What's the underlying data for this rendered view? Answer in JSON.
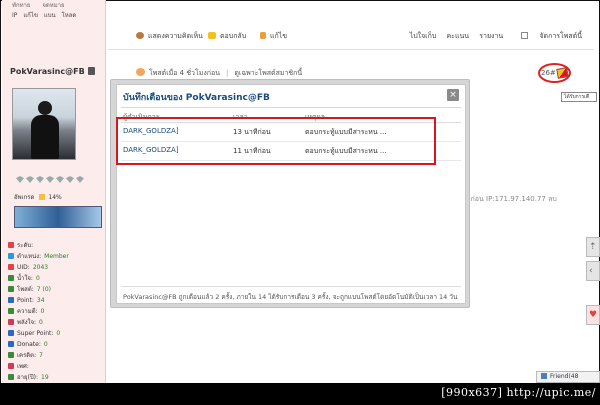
{
  "top_links": {
    "row1": [
      "ทักทาย",
      "จดหมาย"
    ],
    "row2": [
      "IP",
      "แก้ไข",
      "แบน",
      "โหลด"
    ]
  },
  "profile": {
    "username": "PokVarasinc@FB",
    "rank_label": "อัพเกรด",
    "rank_percent": "14%",
    "stats": [
      {
        "icon": "rank-icon",
        "label": "ระดับ:",
        "value": "",
        "color": "#e04444"
      },
      {
        "icon": "position-icon",
        "label": "ตำแหน่ง:",
        "value": "Member",
        "color": "#2a9bd6"
      },
      {
        "icon": "uid-icon",
        "label": "UID:",
        "value": "2043",
        "color": "#e04444"
      },
      {
        "icon": "water-icon",
        "label": "น้ำใจ:",
        "value": "0",
        "color": "#3a8a3a"
      },
      {
        "icon": "post-icon",
        "label": "โพสต์:",
        "value": "7 (0)",
        "color": "#3a8a3a"
      },
      {
        "icon": "point-icon",
        "label": "Point:",
        "value": "34",
        "color": "#2a6ab8"
      },
      {
        "icon": "good-icon",
        "label": "ความดี:",
        "value": "0",
        "color": "#3a8a3a"
      },
      {
        "icon": "heart-icon",
        "label": "พลังใจ:",
        "value": "0",
        "color": "#d23a5a"
      },
      {
        "icon": "super-point-icon",
        "label": "Super Point:",
        "value": "0",
        "color": "#2a6ab8"
      },
      {
        "icon": "donate-icon",
        "label": "Donate:",
        "value": "0",
        "color": "#2a6ab8"
      },
      {
        "icon": "credit-icon",
        "label": "เครดิต:",
        "value": "7",
        "color": "#3a8a3a"
      },
      {
        "icon": "gender-icon",
        "label": "เพศ:",
        "value": "",
        "color": "#d23a5a"
      },
      {
        "icon": "age-icon",
        "label": "อายุ(ปี):",
        "value": "19",
        "color": "#3a8a3a"
      }
    ]
  },
  "toolbar": {
    "comment": "แสดงความคิดเห็น",
    "reply": "ตอบกลับ",
    "edit": "แก้ไข",
    "right_items": [
      "ไปใจเก็บ",
      "คะแนน",
      "รายงาน"
    ],
    "manage": "จัดการโพสต์นี้"
  },
  "post_header": {
    "posted": "โพสต์เมื่อ 4 ชั่วโมงก่อน",
    "members_only": "ดูเฉพาะโพสต์สมาชิกนี้"
  },
  "warnings": {
    "count": "26#",
    "tooltip": "ได้รับการเตื"
  },
  "ip_line": "ตีก่อน IP:171.97.140.77 ลบ",
  "modal": {
    "title": "บันทึกเตือนของ PokVarasinc@FB",
    "close": "×",
    "columns": [
      "ผู้ดำเนินการ",
      "เวลา",
      "เหตุผล"
    ],
    "rows": [
      {
        "user": "DARK_GOLDZA]",
        "time": "13 นาทีก่อน",
        "reason": "ตอบกระทู้แบบมีสาระหน ..."
      },
      {
        "user": "DARK_GOLDZA]",
        "time": "11 นาทีก่อน",
        "reason": "ตอบกระทู้แบบมีสาระหน ..."
      }
    ],
    "footer": "PokVarasinc@FB ถูกเตือนแล้ว 2 ครั้ง, ภายใน 14 ได้รับการเตือน 3 ครั้ง, จะถูกแบนโพสต์โดยอัตโนมัติเป็นเวลา 14 วัน"
  },
  "friend_bar": "Friend(48",
  "watermark": "[990x637] http://upic.me/"
}
